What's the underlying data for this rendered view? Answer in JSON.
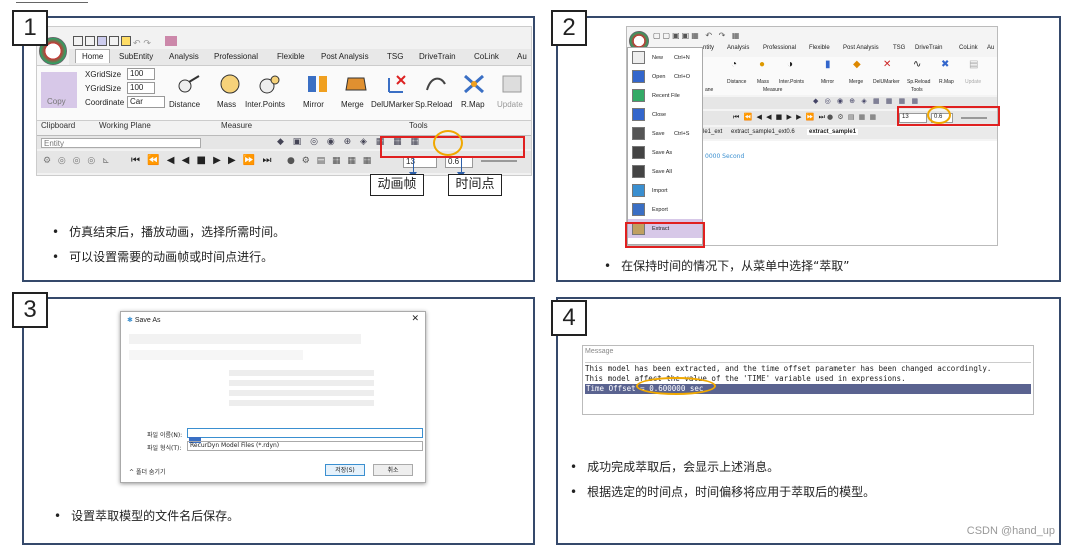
{
  "panels": [
    {
      "number": "1",
      "bullets": [
        "仿真结束后，播放动画，选择所需时间。",
        "可以设置需要的动画帧或时间点进行。"
      ]
    },
    {
      "number": "2",
      "bullets": [
        "在保持时间的情况下，从菜单中选择“萃取”"
      ]
    },
    {
      "number": "3",
      "bullets": [
        "设置萃取模型的文件名后保存。"
      ]
    },
    {
      "number": "4",
      "bullets": [
        "成功完成萃取后，会显示上述消息。",
        "根据选定的时间点，时间偏移将应用于萃取后的模型。"
      ]
    }
  ],
  "p1": {
    "tabs": [
      "Home",
      "SubEntity",
      "Analysis",
      "Professional",
      "Flexible",
      "Post Analysis",
      "TSG",
      "DriveTrain",
      "CoLink",
      "Au"
    ],
    "xgrid_label": "XGridSize",
    "xgrid": "100",
    "ygrid_label": "YGridSize",
    "ygrid": "100",
    "coord_label": "Coordinate",
    "coord": "Car",
    "copy": "Copy",
    "clipboard": "Clipboard",
    "working_plane": "Working Plane",
    "measure": "Measure",
    "tools": "Tools",
    "tools_items": [
      "Distance",
      "Mass",
      "Inter.Points",
      "Mirror",
      "Merge",
      "DelUMarker",
      "Sp.Reload",
      "R.Map",
      "Update"
    ],
    "entity": "Entity",
    "frame": "13",
    "time": "0.6",
    "label_frame": "动画帧",
    "label_time": "时间点"
  },
  "p2": {
    "menu": [
      [
        "New",
        "Ctrl+N"
      ],
      [
        "Open",
        "Ctrl+O"
      ],
      [
        "Recent File",
        ""
      ],
      [
        "Close",
        ""
      ],
      [
        "Save",
        "Ctrl+S"
      ],
      [
        "Save As",
        ""
      ],
      [
        "Save All",
        ""
      ],
      [
        "Import",
        ""
      ],
      [
        "Export",
        ""
      ],
      [
        "Extract",
        ""
      ]
    ],
    "tabs": [
      "ntity",
      "Analysis",
      "Professional",
      "Flexible",
      "Post Analysis",
      "TSG",
      "DriveTrain",
      "CoLink",
      "Au"
    ],
    "tools": [
      "Distance",
      "Mass",
      "Inter.Points",
      "Mirror",
      "Merge",
      "DelUMarker",
      "Sp.Reload",
      "R.Map",
      "Update"
    ],
    "measure": "Measure",
    "tools_label": "Tools",
    "ane": "ane",
    "frame": "13",
    "time": "0.6",
    "doc_tabs": [
      "le1_ext",
      "extract_sample1_ext0.6",
      "extract_sample1"
    ],
    "status": "0000 Second"
  },
  "p3": {
    "title": "Save As",
    "close": "✕",
    "filename_label": "파일 이름(N):",
    "filetype_label": "파일 형식(T):",
    "filetype": "RecurDyn Model Files (*.rdyn)",
    "save": "저장(S)",
    "cancel": "취소",
    "hide": "폴더 숨기기"
  },
  "p4": {
    "title": "Message",
    "lines": [
      "This model has been extracted, and the time offset parameter has been changed accordingly.",
      "This model affect the value of the 'TIME' variable used in expressions.",
      "Time Offset = 0.600000 sec"
    ]
  },
  "watermark": "CSDN @hand_up"
}
